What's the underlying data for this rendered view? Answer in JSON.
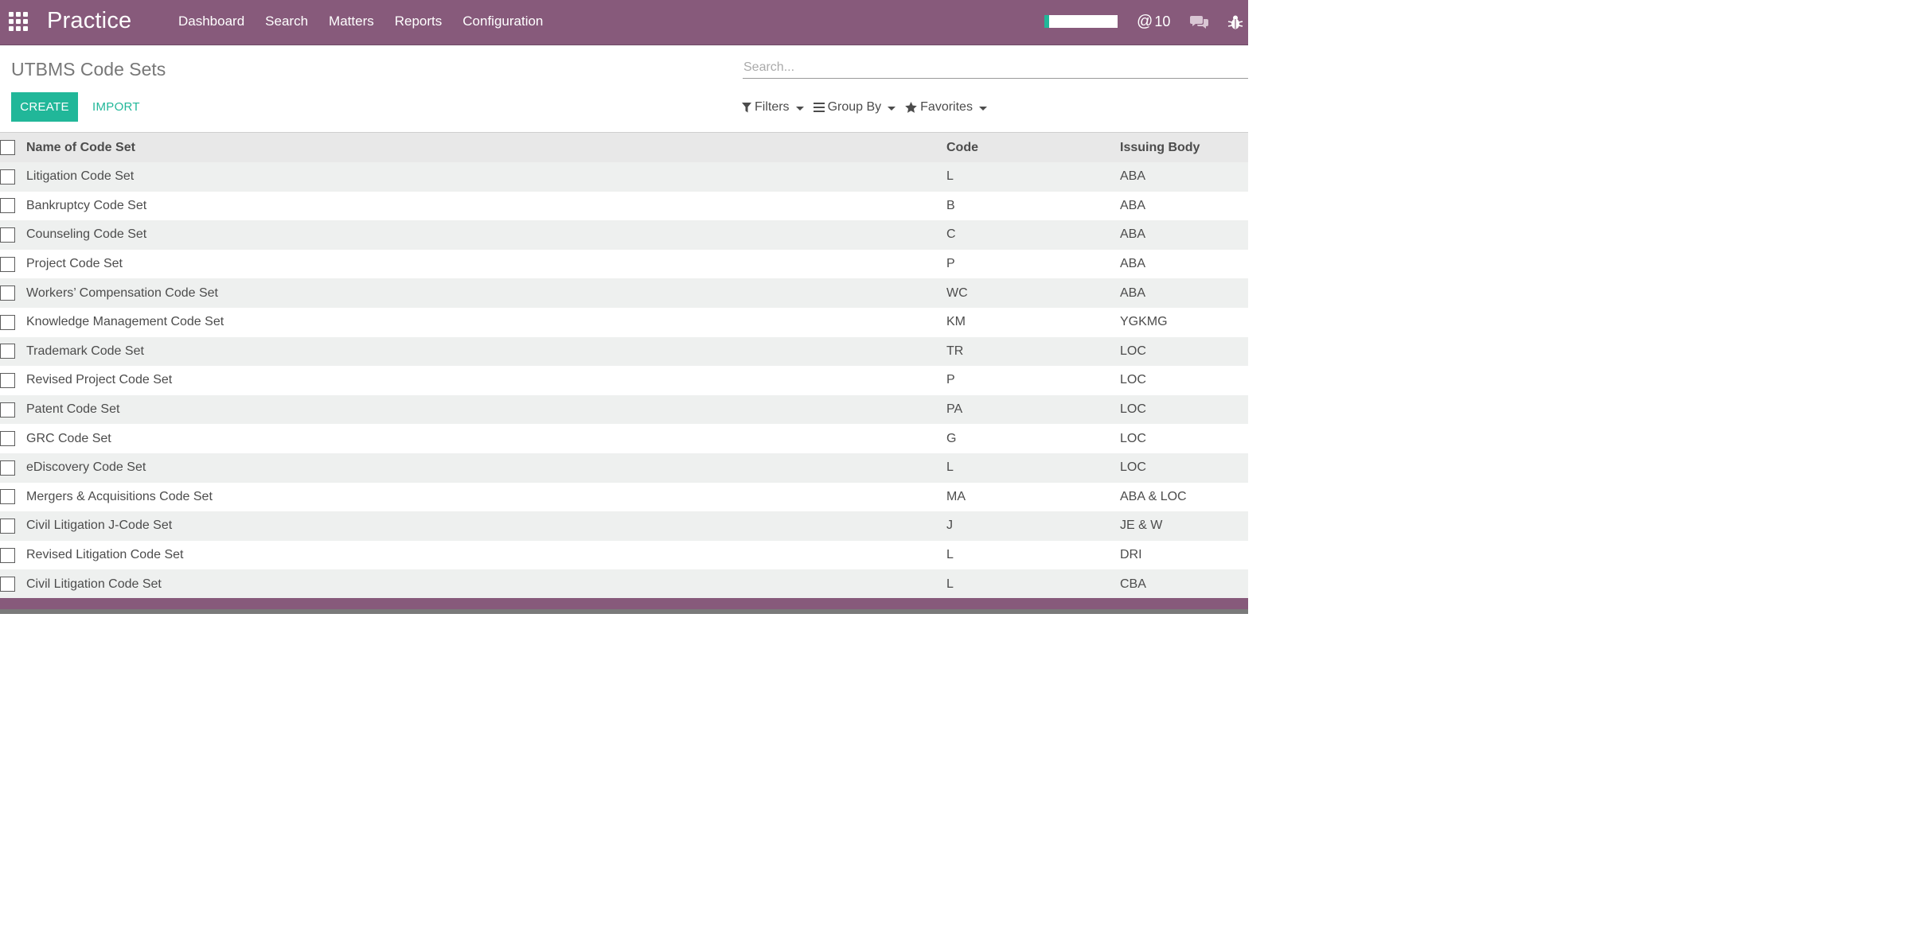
{
  "navbar": {
    "brand": "Practice",
    "menu": [
      "Dashboard",
      "Search",
      "Matters",
      "Reports",
      "Configuration"
    ],
    "progress_percent": 6,
    "mention_count": "10",
    "accent_color": "#875a7b"
  },
  "control_panel": {
    "title": "UTBMS Code Sets",
    "search_placeholder": "Search...",
    "create_label": "CREATE",
    "import_label": "IMPORT",
    "filters_label": "Filters",
    "groupby_label": "Group By",
    "favorites_label": "Favorites",
    "primary_color": "#21b799"
  },
  "table": {
    "headers": [
      "Name of Code Set",
      "Code",
      "Issuing Body"
    ],
    "rows": [
      [
        "Litigation Code Set",
        "L",
        "ABA"
      ],
      [
        "Bankruptcy Code Set",
        "B",
        "ABA"
      ],
      [
        "Counseling Code Set",
        "C",
        "ABA"
      ],
      [
        "Project Code Set",
        "P",
        "ABA"
      ],
      [
        "Workers’ Compensation Code Set",
        "WC",
        "ABA"
      ],
      [
        "Knowledge Management Code Set",
        "KM",
        "YGKMG"
      ],
      [
        "Trademark Code Set",
        "TR",
        "LOC"
      ],
      [
        "Revised Project Code Set",
        "P",
        "LOC"
      ],
      [
        "Patent Code Set",
        "PA",
        "LOC"
      ],
      [
        "GRC Code Set",
        "G",
        "LOC"
      ],
      [
        "eDiscovery Code Set",
        "L",
        "LOC"
      ],
      [
        "Mergers & Acquisitions Code Set",
        "MA",
        "ABA & LOC"
      ],
      [
        "Civil Litigation J-Code Set",
        "J",
        "JE & W"
      ],
      [
        "Revised Litigation Code Set",
        "L",
        "DRI"
      ],
      [
        "Civil Litigation Code Set",
        "L",
        "CBA"
      ]
    ]
  }
}
